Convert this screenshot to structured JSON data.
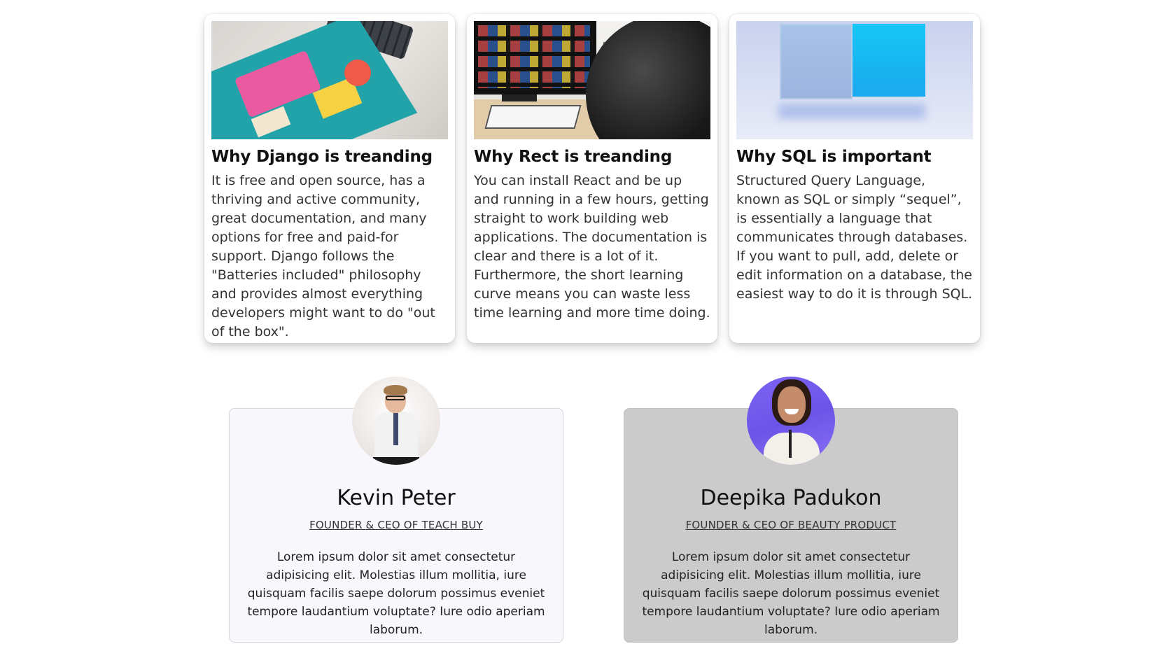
{
  "cards": [
    {
      "image": "two-scoops-of-django-book-photo",
      "title": "Why Django is treanding",
      "text": "It is free and open source, has a thriving and active community, great documentation, and many options for free and paid-for support. Django follows the \"Batteries included\" philosophy and provides almost everything developers might want to do \"out of the box\"."
    },
    {
      "image": "monitor-and-headphones-photo",
      "title": "Why Rect is treanding",
      "text": "You can install React and be up and running in a few hours, getting straight to work building web applications. The documentation is clear and there is a lot of it. Furthermore, the short learning curve means you can waste less time learning and more time doing."
    },
    {
      "image": "blue-boxes-render",
      "title": "Why SQL is important",
      "text": "Structured Query Language, known as SQL or simply “sequel”, is essentially a language that communicates through databases. If you want to pull, add, delete or edit information on a database, the easiest way to do it is through SQL."
    }
  ],
  "testimonials": [
    {
      "avatar": "man-in-white-shirt-portrait",
      "name": "Kevin Peter",
      "role": "FOUNDER & CEO OF TEACH BUY",
      "text": "Lorem ipsum dolor sit amet consectetur adipisicing elit. Molestias illum mollitia, iure quisquam facilis saepe dolorum possimus eveniet tempore laudantium voluptate? Iure odio aperiam laborum.",
      "background": "#f7f7fc"
    },
    {
      "avatar": "smiling-woman-portrait",
      "name": "Deepika Padukon",
      "role": "FOUNDER & CEO OF BEAUTY PRODUCT",
      "text": "Lorem ipsum dolor sit amet consectetur adipisicing elit. Molestias illum mollitia, iure quisquam facilis saepe dolorum possimus eveniet tempore laudantium voluptate? Iure odio aperiam laborum.",
      "background": "#cbcbcb"
    }
  ]
}
